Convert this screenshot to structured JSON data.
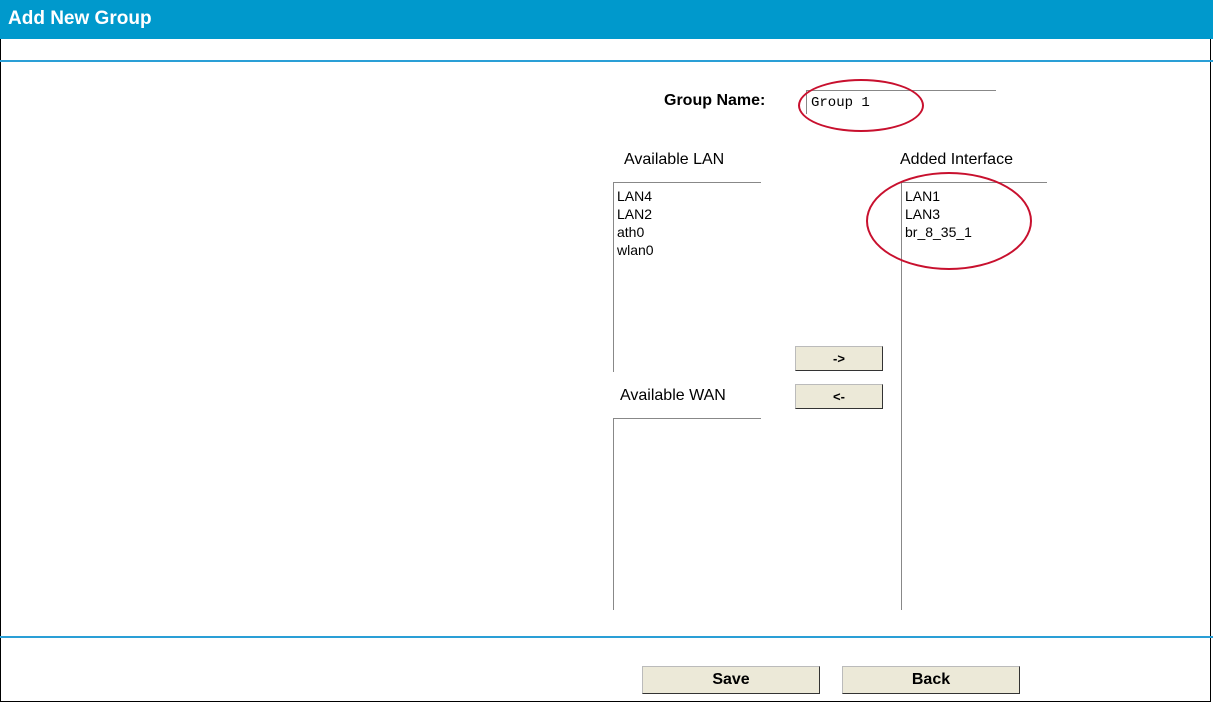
{
  "header": {
    "title": "Add New Group"
  },
  "group": {
    "label": "Group Name:",
    "value": "Group 1"
  },
  "available_lan": {
    "label": "Available LAN",
    "items": [
      "LAN4",
      "LAN2",
      "ath0",
      "wlan0"
    ]
  },
  "available_wan": {
    "label": "Available WAN",
    "items": []
  },
  "added_interface": {
    "label": "Added Interface",
    "items": [
      "LAN1",
      "LAN3",
      "br_8_35_1"
    ]
  },
  "buttons": {
    "add": "->",
    "remove": "<-",
    "save": "Save",
    "back": "Back"
  },
  "colors": {
    "header": "#0099cc",
    "annotation": "#c8102e",
    "button": "#ece9d8"
  }
}
